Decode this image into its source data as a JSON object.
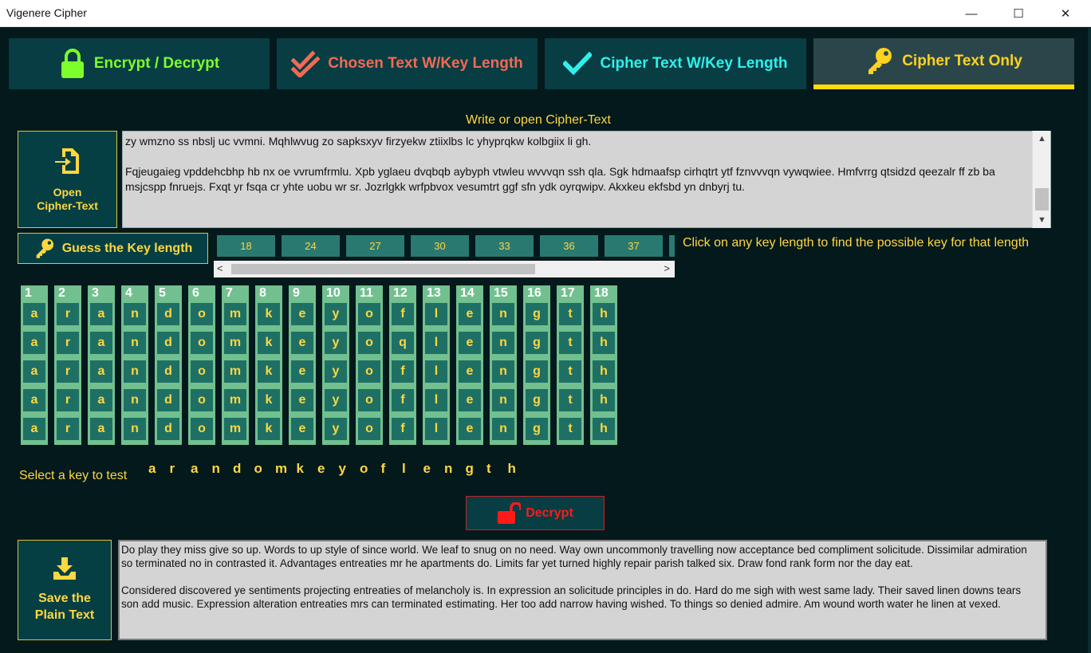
{
  "window": {
    "title": "Vigenere Cipher",
    "min_glyph": "—",
    "max_glyph": "☐",
    "close_glyph": "✕"
  },
  "tabs": [
    {
      "label": "Encrypt / Decrypt",
      "icon": "lock-icon",
      "color": "#7cff2b"
    },
    {
      "label": "Chosen Text W/Key Length",
      "icon": "double-check-icon",
      "color": "#f26a55"
    },
    {
      "label": "Cipher Text W/Key Length",
      "icon": "check-icon",
      "color": "#2ff0ec"
    },
    {
      "label": "Cipher Text Only",
      "icon": "key-icon",
      "color": "#ffd21f",
      "active": true
    }
  ],
  "cipher": {
    "caption": "Write or open Cipher-Text",
    "open_button_line1": "Open",
    "open_button_line2": "Cipher-Text",
    "text_para1": "zy wmzno ss nbslj uc vvmni. Mqhlwvug zo sapksxyv firzyekw ztiixlbs lc yhyprqkw kolbgiix li gh.",
    "text_para2": "Fqjeugaieg vpddehcbhp hb nx oe vvrumfrmlu. Xpb yglaeu dvqbqb aybyph vtwleu wvvvqn ssh qla. Sgk hdmaafsp cirhqtrt ytf fznvvvqn vywqwiee. Hmfvrrg qtsidzd qeezalr ff zb ba msjcspp fnruejs. Fxqt yr fsqa cr yhte uobu wr sr. Jozrlgkk wrfpbvox vesumtrt ggf sfn ydk oyrqwipv. Akxkeu ekfsbd yn dnbyrj tu."
  },
  "guess": {
    "button_label": "Guess the Key length",
    "key_lengths": [
      "18",
      "24",
      "27",
      "30",
      "33",
      "36",
      "37"
    ],
    "hint": "Click on any key length to find the possible key for that length"
  },
  "grid": {
    "columns": [
      {
        "num": "1",
        "letters": [
          "a",
          "a",
          "a",
          "a",
          "a"
        ]
      },
      {
        "num": "2",
        "letters": [
          "r",
          "r",
          "r",
          "r",
          "r"
        ]
      },
      {
        "num": "3",
        "letters": [
          "a",
          "a",
          "a",
          "a",
          "a"
        ]
      },
      {
        "num": "4",
        "letters": [
          "n",
          "n",
          "n",
          "n",
          "n"
        ]
      },
      {
        "num": "5",
        "letters": [
          "d",
          "d",
          "d",
          "d",
          "d"
        ]
      },
      {
        "num": "6",
        "letters": [
          "o",
          "o",
          "o",
          "o",
          "o"
        ]
      },
      {
        "num": "7",
        "letters": [
          "m",
          "m",
          "m",
          "m",
          "m"
        ]
      },
      {
        "num": "8",
        "letters": [
          "k",
          "k",
          "k",
          "k",
          "k"
        ]
      },
      {
        "num": "9",
        "letters": [
          "e",
          "e",
          "e",
          "e",
          "e"
        ]
      },
      {
        "num": "10",
        "letters": [
          "y",
          "y",
          "y",
          "y",
          "y"
        ]
      },
      {
        "num": "11",
        "letters": [
          "o",
          "o",
          "o",
          "o",
          "o"
        ]
      },
      {
        "num": "12",
        "letters": [
          "f",
          "q",
          "f",
          "f",
          "f"
        ]
      },
      {
        "num": "13",
        "letters": [
          "l",
          "l",
          "l",
          "l",
          "l"
        ]
      },
      {
        "num": "14",
        "letters": [
          "e",
          "e",
          "e",
          "e",
          "e"
        ]
      },
      {
        "num": "15",
        "letters": [
          "n",
          "n",
          "n",
          "n",
          "n"
        ]
      },
      {
        "num": "16",
        "letters": [
          "g",
          "g",
          "g",
          "g",
          "g"
        ]
      },
      {
        "num": "17",
        "letters": [
          "t",
          "t",
          "t",
          "t",
          "t"
        ]
      },
      {
        "num": "18",
        "letters": [
          "h",
          "h",
          "h",
          "h",
          "h"
        ]
      }
    ]
  },
  "key_select": {
    "label": "Select a key to test",
    "letters": [
      "a",
      "r",
      "a",
      "n",
      "d",
      "o",
      "m",
      "k",
      "e",
      "y",
      "o",
      "f",
      "l",
      "e",
      "n",
      "g",
      "t",
      "h"
    ]
  },
  "decrypt": {
    "button_label": "Decrypt"
  },
  "plain": {
    "save_line1": "Save the",
    "save_line2": "Plain Text",
    "text_para1": "Do play they miss give so up. Words to up style of since world. We leaf to snug on no need. Way own uncommonly travelling now acceptance bed compliment solicitude. Dissimilar admiration so terminated no in contrasted it. Advantages entreaties mr he apartments do. Limits far yet turned highly repair parish talked six. Draw fond rank form nor the day eat.",
    "text_para2": "Considered discovered ye sentiments projecting entreaties of melancholy is. In expression an solicitude principles in do. Hard do me sigh with west same lady. Their saved linen downs tears son add music. Expression alteration entreaties mrs can terminated estimating. Her too add narrow having wished. To things so denied admire. Am wound worth water he linen at vexed."
  }
}
